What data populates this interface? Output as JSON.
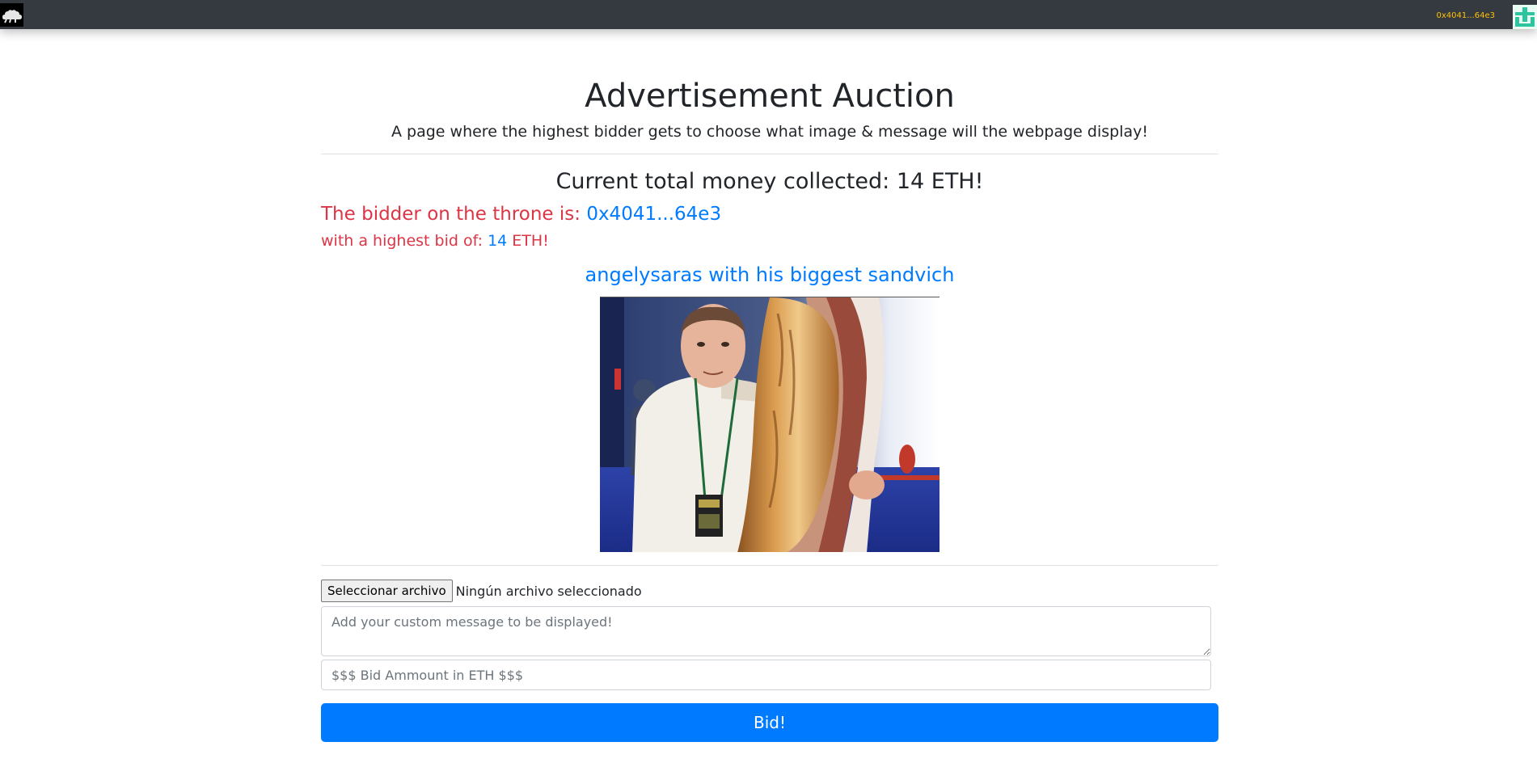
{
  "navbar": {
    "logo_icon": "cloud-logo-icon",
    "account": "0x4041...64e3",
    "avatar_icon": "identicon-avatar-icon"
  },
  "header": {
    "title": "Advertisement Auction",
    "subtitle": "A page where the highest bidder gets to choose what image & message will the webpage display!"
  },
  "stats": {
    "total_collected": "Current total money collected: 14 ETH!",
    "throne_prefix": "The bidder on the throne is: ",
    "throne_address": "0x4041...64e3",
    "highest_bid_prefix": "with a highest bid of: ",
    "highest_bid_amount": "14",
    "highest_bid_suffix": " ETH!"
  },
  "advertisement": {
    "message": "angelysaras with his biggest sandvich",
    "image_icon": "advertisement-photo"
  },
  "form": {
    "file_button_label": "Seleccionar archivo",
    "file_status": "Ningún archivo seleccionado",
    "message_placeholder": "Add your custom message to be displayed!",
    "bid_placeholder": "$$$ Bid Ammount in ETH $$$",
    "bid_button_label": "Bid!"
  },
  "colors": {
    "navbar": "#343a40",
    "account_text": "#ffc107",
    "danger": "#dc3545",
    "primary": "#007bff"
  }
}
